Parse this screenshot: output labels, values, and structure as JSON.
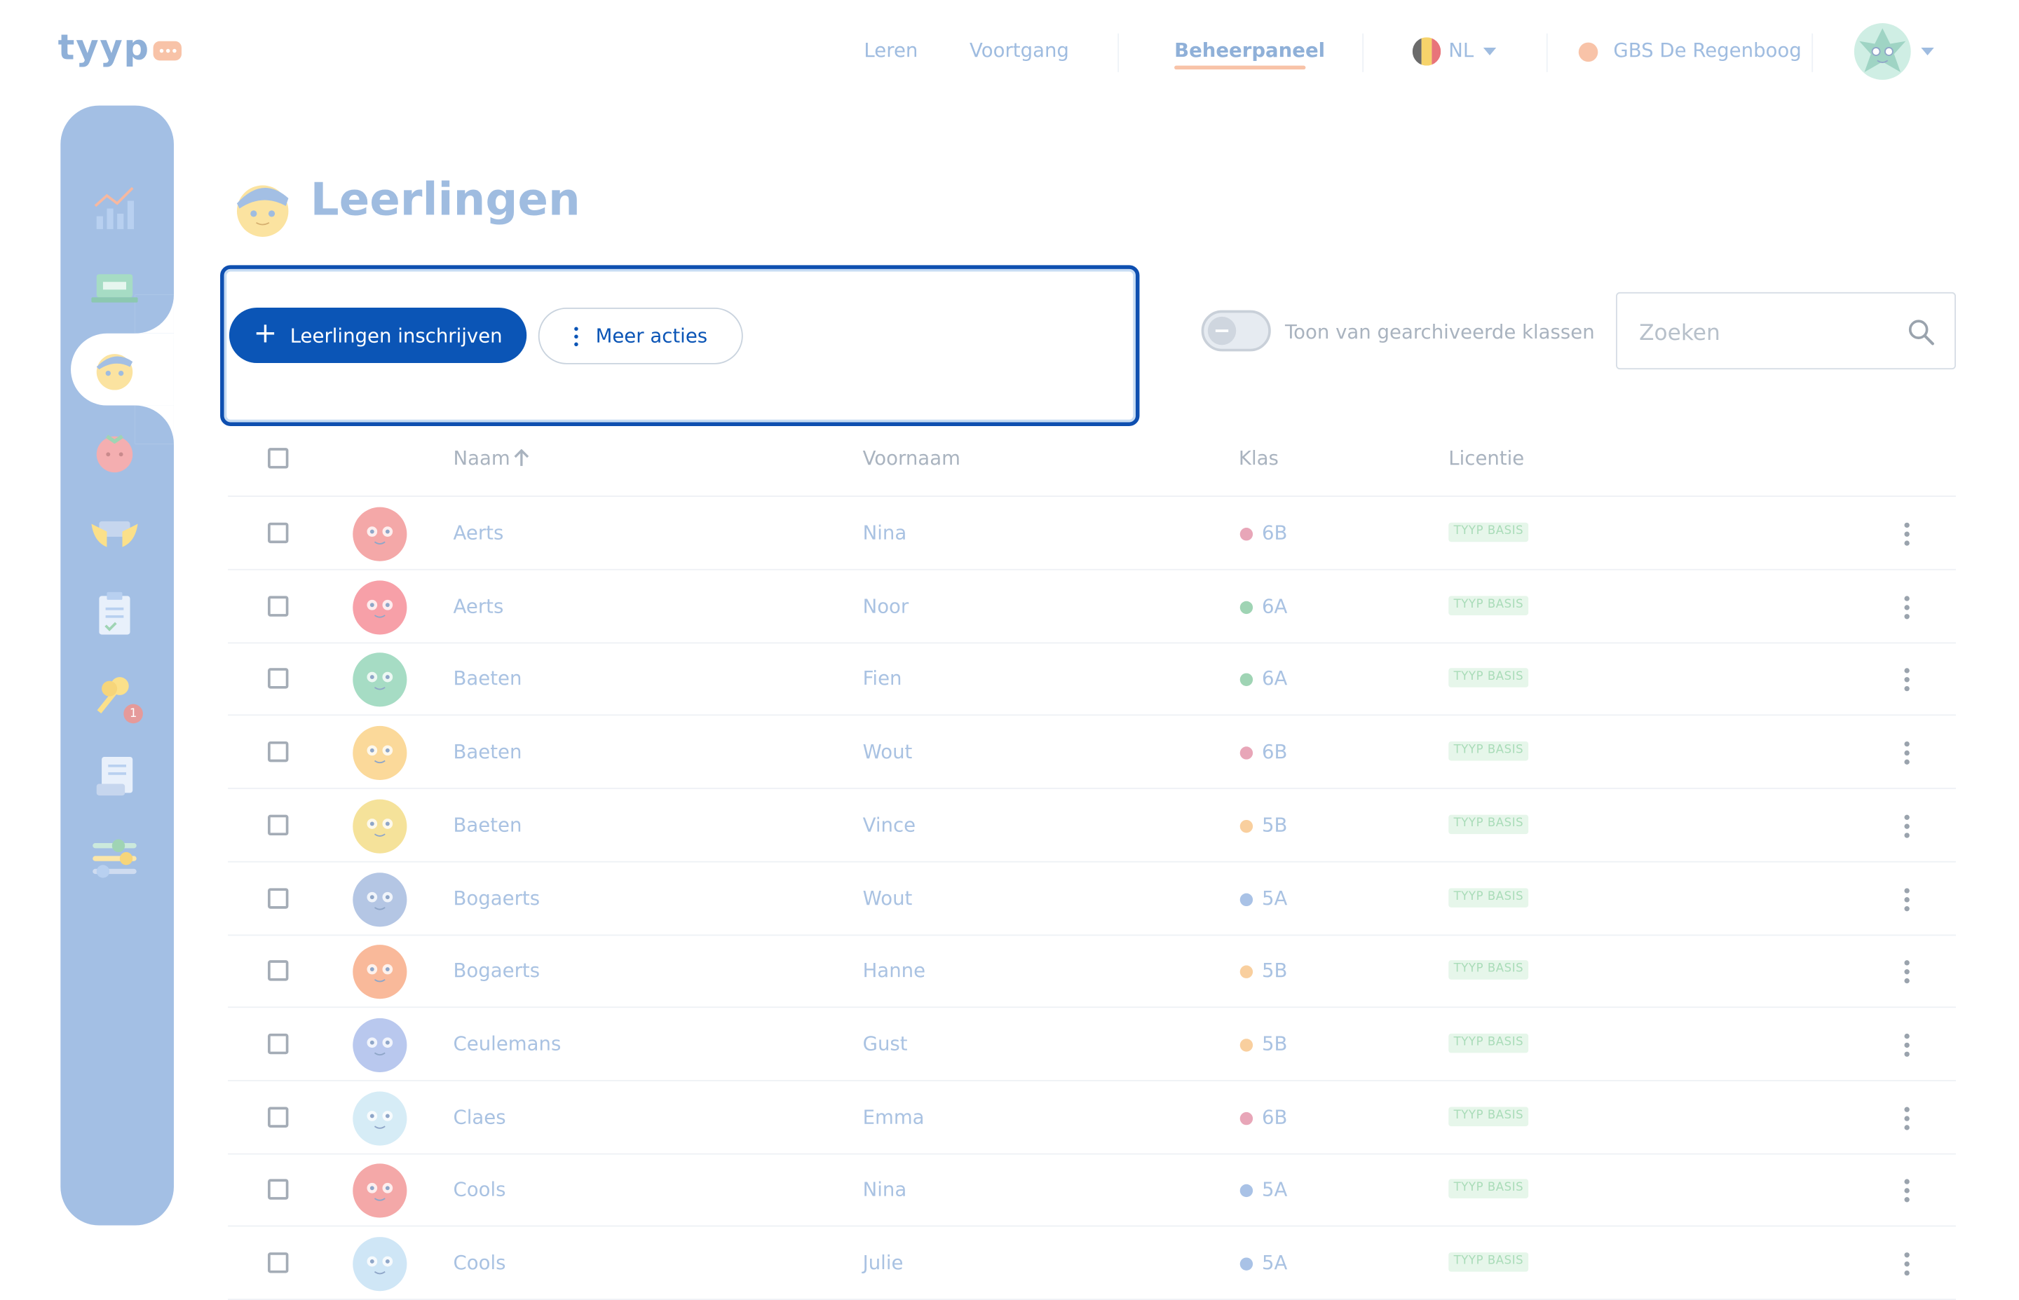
{
  "brand": {
    "name": "tyyp"
  },
  "topnav": {
    "leren": "Leren",
    "voortgang": "Voortgang",
    "beheerpaneel": "Beheerpaneel",
    "language": "NL",
    "school": "GBS De Regenboog"
  },
  "page": {
    "title": "Leerlingen"
  },
  "actions": {
    "enroll_label": "Leerlingen inschrijven",
    "more_label": "Meer acties",
    "toggle_label": "Toon van gearchiveerde klassen"
  },
  "search": {
    "placeholder": "Zoeken"
  },
  "sidebar": {
    "keys_badge": "1"
  },
  "table": {
    "headers": {
      "naam": "Naam",
      "voornaam": "Voornaam",
      "klas": "Klas",
      "licentie": "Licentie"
    },
    "rows": [
      {
        "naam": "Aerts",
        "voornaam": "Nina",
        "klas": "6B",
        "licentie": "TYYP BASIS",
        "klas_color": "#e8a6b8",
        "avatar_color": "#f4a8a8"
      },
      {
        "naam": "Aerts",
        "voornaam": "Noor",
        "klas": "6A",
        "licentie": "TYYP BASIS",
        "klas_color": "#9fd4b4",
        "avatar_color": "#f7a0a8"
      },
      {
        "naam": "Baeten",
        "voornaam": "Fien",
        "klas": "6A",
        "licentie": "TYYP BASIS",
        "klas_color": "#9fd4b4",
        "avatar_color": "#a6dcc4"
      },
      {
        "naam": "Baeten",
        "voornaam": "Wout",
        "klas": "6B",
        "licentie": "TYYP BASIS",
        "klas_color": "#e8a6b8",
        "avatar_color": "#fbd99a"
      },
      {
        "naam": "Baeten",
        "voornaam": "Vince",
        "klas": "5B",
        "licentie": "TYYP BASIS",
        "klas_color": "#f9cf9e",
        "avatar_color": "#f5e29a"
      },
      {
        "naam": "Bogaerts",
        "voornaam": "Wout",
        "klas": "5A",
        "licentie": "TYYP BASIS",
        "klas_color": "#a9c2e6",
        "avatar_color": "#b4c6e4"
      },
      {
        "naam": "Bogaerts",
        "voornaam": "Hanne",
        "klas": "5B",
        "licentie": "TYYP BASIS",
        "klas_color": "#f9cf9e",
        "avatar_color": "#f9b99a"
      },
      {
        "naam": "Ceulemans",
        "voornaam": "Gust",
        "klas": "5B",
        "licentie": "TYYP BASIS",
        "klas_color": "#f9cf9e",
        "avatar_color": "#b9c8ee"
      },
      {
        "naam": "Claes",
        "voornaam": "Emma",
        "klas": "6B",
        "licentie": "TYYP BASIS",
        "klas_color": "#e8a6b8",
        "avatar_color": "#d6ecf6"
      },
      {
        "naam": "Cools",
        "voornaam": "Nina",
        "klas": "5A",
        "licentie": "TYYP BASIS",
        "klas_color": "#a9c2e6",
        "avatar_color": "#f4a8a8"
      },
      {
        "naam": "Cools",
        "voornaam": "Julie",
        "klas": "5A",
        "licentie": "TYYP BASIS",
        "klas_color": "#a9c2e6",
        "avatar_color": "#cfe6f6"
      }
    ]
  }
}
